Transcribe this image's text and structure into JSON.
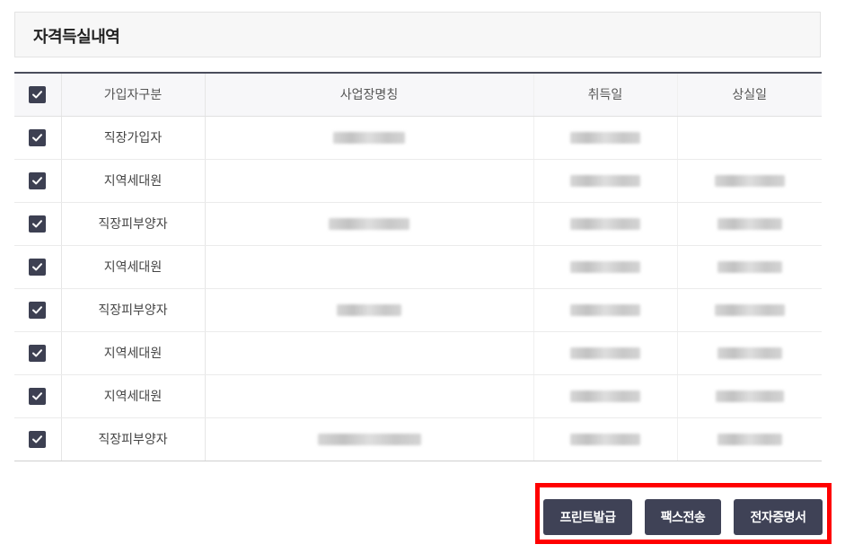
{
  "section": {
    "title": "자격득실내역"
  },
  "table": {
    "headers": {
      "type": "가입자구분",
      "business": "사업장명칭",
      "acquired": "취득일",
      "lost": "상실일"
    },
    "rows": [
      {
        "type": "직장가입자",
        "checked": true
      },
      {
        "type": "지역세대원",
        "checked": true
      },
      {
        "type": "직장피부양자",
        "checked": true
      },
      {
        "type": "지역세대원",
        "checked": true
      },
      {
        "type": "직장피부양자",
        "checked": true
      },
      {
        "type": "지역세대원",
        "checked": true
      },
      {
        "type": "지역세대원",
        "checked": true
      },
      {
        "type": "직장피부양자",
        "checked": true
      }
    ]
  },
  "actions": {
    "print_label": "프린트발급",
    "fax_label": "팩스전송",
    "ecert_label": "전자증명서"
  },
  "colors": {
    "accent": "#3f4256",
    "highlight": "#ff0000"
  }
}
